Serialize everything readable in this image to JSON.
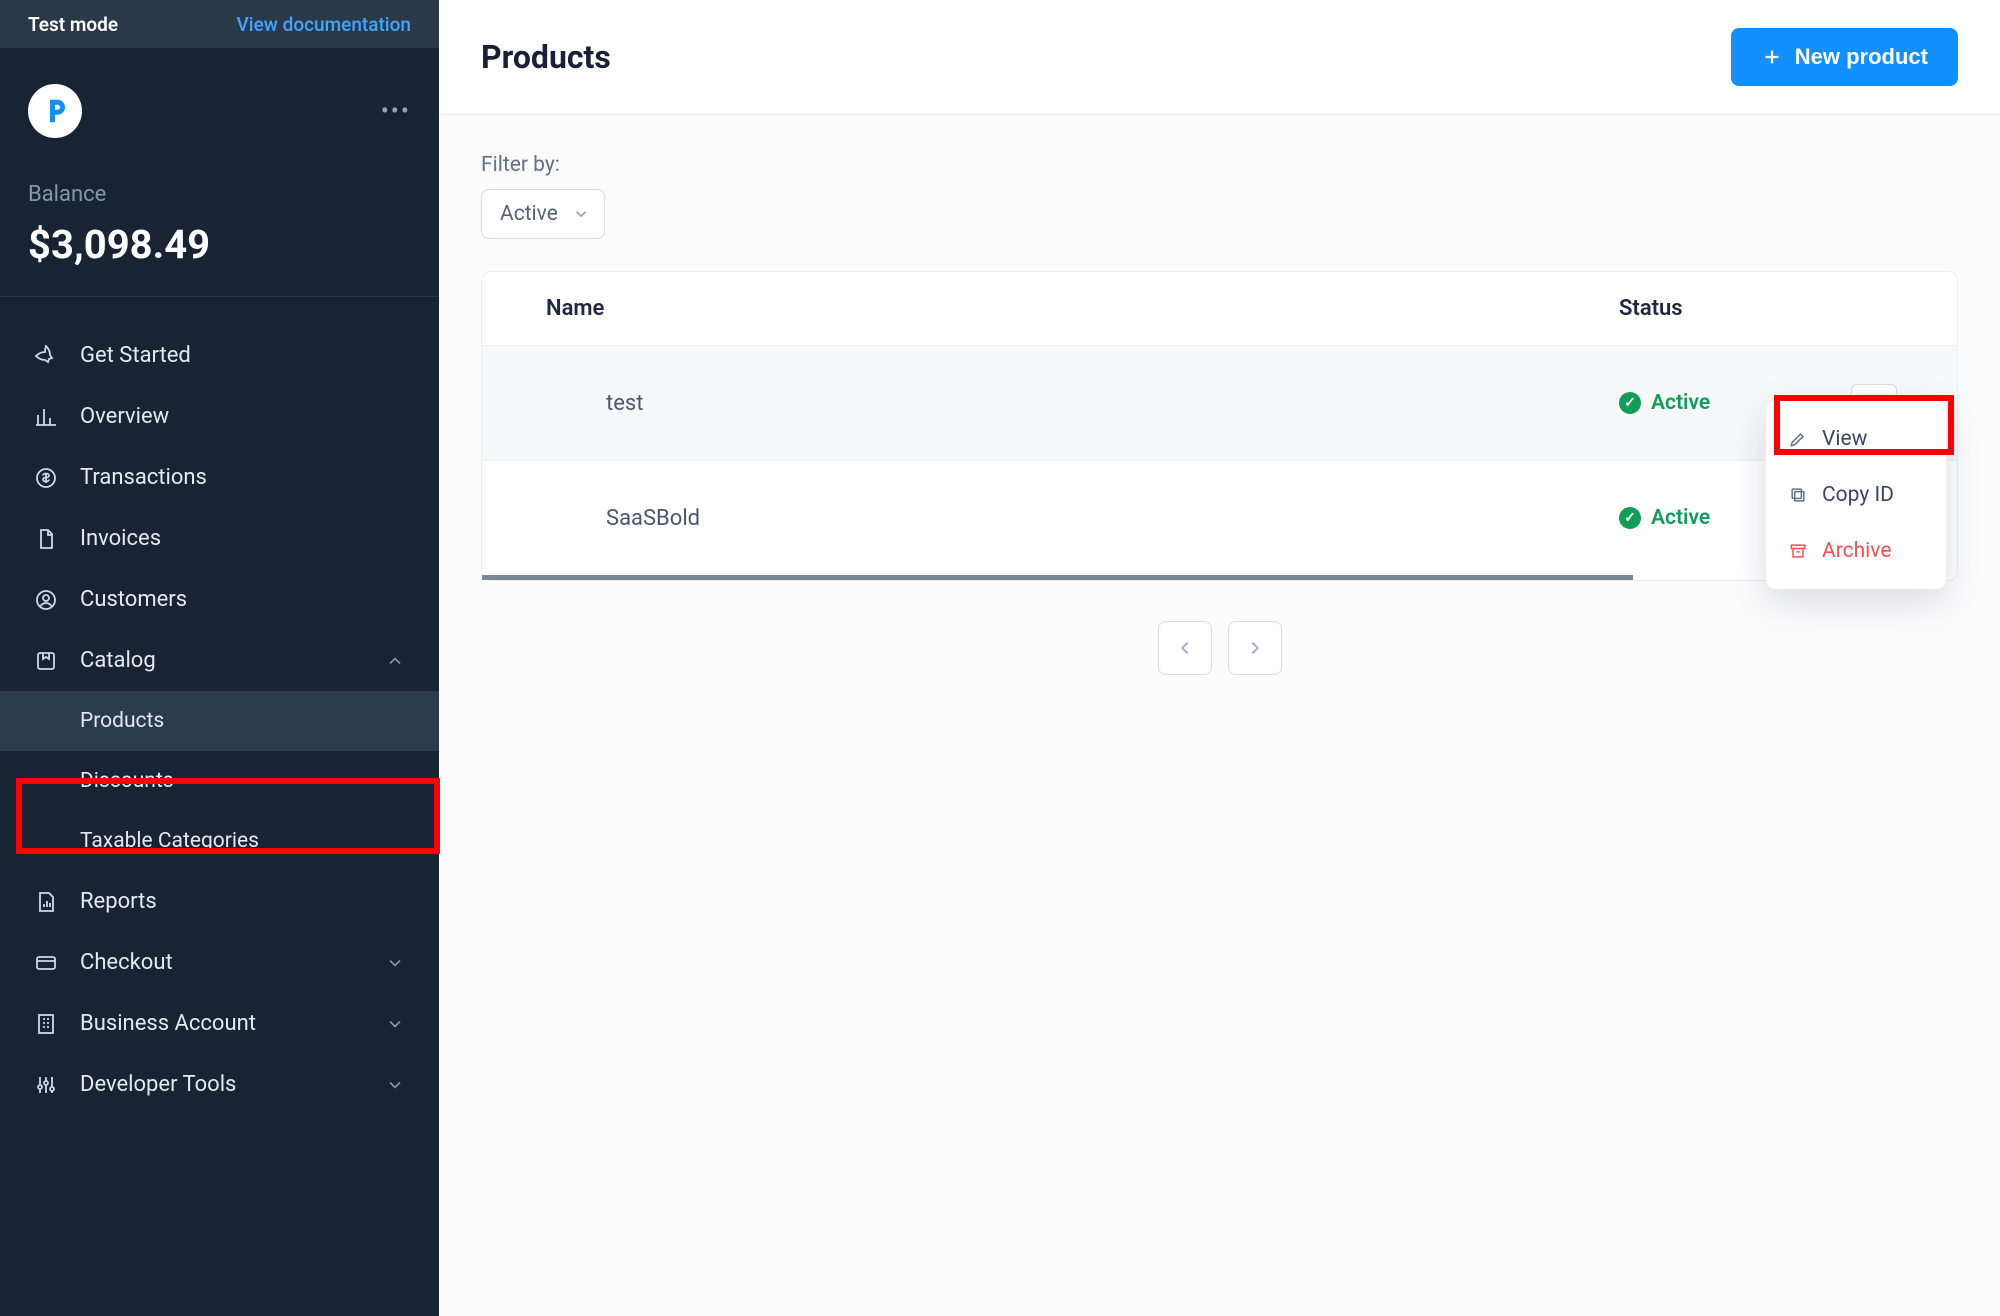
{
  "sidebar": {
    "test_mode": "Test mode",
    "view_docs": "View documentation",
    "balance_label": "Balance",
    "balance_amount": "$3,098.49",
    "items": {
      "get_started": "Get Started",
      "overview": "Overview",
      "transactions": "Transactions",
      "invoices": "Invoices",
      "customers": "Customers",
      "catalog": "Catalog",
      "products": "Products",
      "discounts": "Discounts",
      "taxable": "Taxable Categories",
      "reports": "Reports",
      "checkout": "Checkout",
      "business": "Business Account",
      "devtools": "Developer Tools"
    }
  },
  "header": {
    "title": "Products",
    "new_button": "New product"
  },
  "filter": {
    "label": "Filter by:",
    "value": "Active"
  },
  "table": {
    "headers": {
      "name": "Name",
      "status": "Status"
    },
    "rows": [
      {
        "name": "test",
        "status": "Active"
      },
      {
        "name": "SaaSBold",
        "status": "Active"
      }
    ]
  },
  "dropdown": {
    "view": "View",
    "copy_id": "Copy ID",
    "archive": "Archive"
  }
}
